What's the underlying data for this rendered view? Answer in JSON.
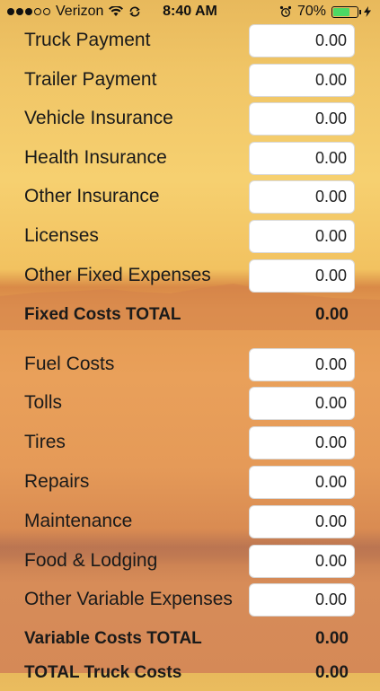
{
  "status_bar": {
    "carrier": "Verizon",
    "time": "8:40 AM",
    "battery_percent": "70%",
    "battery_level": 0.7,
    "signal_bars_filled": 3,
    "signal_bars_total": 5
  },
  "fixed": [
    {
      "label": "Truck Payment",
      "value": "0.00"
    },
    {
      "label": "Trailer Payment",
      "value": "0.00"
    },
    {
      "label": "Vehicle Insurance",
      "value": "0.00"
    },
    {
      "label": "Health Insurance",
      "value": "0.00"
    },
    {
      "label": "Other Insurance",
      "value": "0.00"
    },
    {
      "label": "Licenses",
      "value": "0.00"
    },
    {
      "label": "Other Fixed Expenses",
      "value": "0.00"
    }
  ],
  "fixed_total": {
    "label": "Fixed Costs TOTAL",
    "value": "0.00"
  },
  "variable": [
    {
      "label": "Fuel Costs",
      "value": "0.00"
    },
    {
      "label": "Tolls",
      "value": "0.00"
    },
    {
      "label": "Tires",
      "value": "0.00"
    },
    {
      "label": "Repairs",
      "value": "0.00"
    },
    {
      "label": "Maintenance",
      "value": "0.00"
    },
    {
      "label": "Food & Lodging",
      "value": "0.00"
    },
    {
      "label": "Other Variable Expenses",
      "value": "0.00"
    }
  ],
  "variable_total": {
    "label": "Variable Costs TOTAL",
    "value": "0.00"
  },
  "truck_total": {
    "label": "TOTAL Truck Costs",
    "value": "0.00"
  },
  "colors": {
    "battery_fill": "#4cd964",
    "text": "#1a1a1a",
    "field_background": "#ffffff"
  }
}
